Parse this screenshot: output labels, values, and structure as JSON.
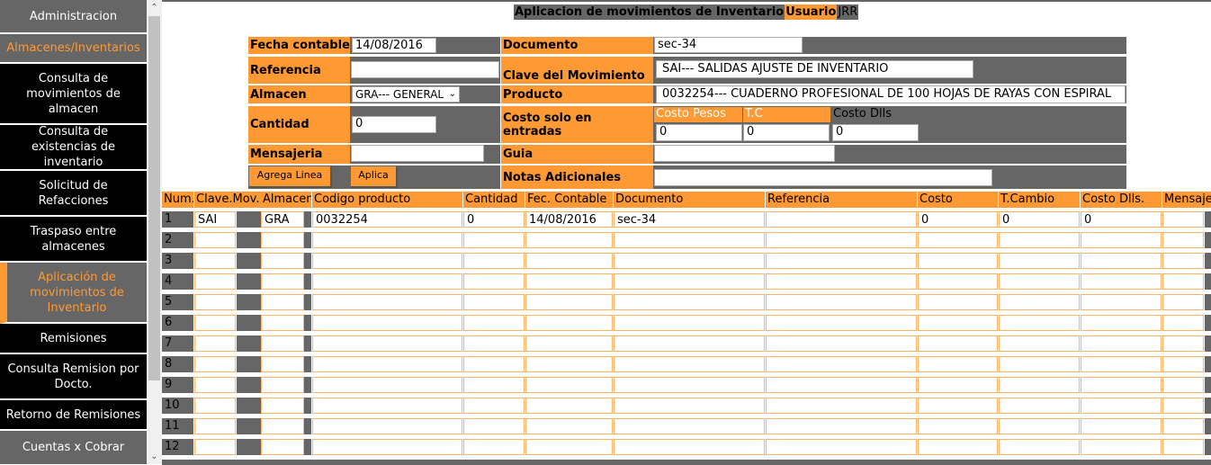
{
  "sidebar": {
    "items": [
      {
        "label": "Administracion"
      },
      {
        "label": "Almacenes/Inventarios"
      },
      {
        "label": "Consulta de movimientos de almacen"
      },
      {
        "label": "Consulta de existencias de inventario"
      },
      {
        "label": "Solicitud de Refacciones"
      },
      {
        "label": "Traspaso entre almacenes"
      },
      {
        "label": "Aplicación de movimientos de Inventario"
      },
      {
        "label": "Remisiones"
      },
      {
        "label": "Consulta Remision por Docto."
      },
      {
        "label": "Retorno de Remisiones"
      },
      {
        "label": "Cuentas x Cobrar"
      }
    ]
  },
  "header": {
    "title": "Aplicacion de movimientos de Inventario",
    "user_label": "Usuario",
    "user_value": "JRR"
  },
  "form": {
    "fecha_label": "Fecha contable",
    "fecha_value": "14/08/2016",
    "documento_label": "Documento",
    "documento_value": "sec-34",
    "referencia_label": "Referencia",
    "referencia_value": "",
    "clave_label": "Clave del Movimiento",
    "clave_value": "SAI--- SALIDAS AJUSTE DE INVENTARIO",
    "almacen_label": "Almacen",
    "almacen_value": "GRA--- GENERAL",
    "producto_label": "Producto",
    "producto_value": "0032254--- CUADERNO PROFESIONAL DE 100 HOJAS DE RAYAS CON ESPIRAL",
    "cantidad_label": "Cantidad",
    "cantidad_value": "0",
    "costo_label": "Costo solo en entradas",
    "costo_pesos_label": "Costo Pesos",
    "costo_pesos_value": "0",
    "tc_label": "T.C",
    "tc_value": "0",
    "costo_dlls_label": "Costo Dlls",
    "costo_dlls_value": "0",
    "mensajeria_label": "Mensajeria",
    "mensajeria_value": "",
    "guia_label": "Guia",
    "guia_value": "",
    "notas_label": "Notas Adicionales",
    "notas_value": "",
    "agrega_button": "Agrega Linea",
    "aplica_button": "Aplica"
  },
  "grid": {
    "headers": [
      "Num.",
      "Clave.Mov.",
      "Almacen",
      "Codigo producto",
      "Cantidad",
      "Fec. Contable",
      "Documento",
      "Referencia",
      "Costo",
      "T.Cambio",
      "Costo Dlls.",
      "Mensaje"
    ],
    "rows": [
      {
        "num": "1",
        "clave": "SAI",
        "almacen": "GRA",
        "codigo": "0032254",
        "cantidad": "0",
        "fecha": "14/08/2016",
        "documento": "sec-34",
        "referencia": "",
        "costo": "0",
        "tcambio": "0",
        "costo_dlls": "0",
        "mensaje": ""
      },
      {
        "num": "2",
        "clave": "",
        "almacen": "",
        "codigo": "",
        "cantidad": "",
        "fecha": "",
        "documento": "",
        "referencia": "",
        "costo": "",
        "tcambio": "",
        "costo_dlls": "",
        "mensaje": ""
      },
      {
        "num": "3",
        "clave": "",
        "almacen": "",
        "codigo": "",
        "cantidad": "",
        "fecha": "",
        "documento": "",
        "referencia": "",
        "costo": "",
        "tcambio": "",
        "costo_dlls": "",
        "mensaje": ""
      },
      {
        "num": "4",
        "clave": "",
        "almacen": "",
        "codigo": "",
        "cantidad": "",
        "fecha": "",
        "documento": "",
        "referencia": "",
        "costo": "",
        "tcambio": "",
        "costo_dlls": "",
        "mensaje": ""
      },
      {
        "num": "5",
        "clave": "",
        "almacen": "",
        "codigo": "",
        "cantidad": "",
        "fecha": "",
        "documento": "",
        "referencia": "",
        "costo": "",
        "tcambio": "",
        "costo_dlls": "",
        "mensaje": ""
      },
      {
        "num": "6",
        "clave": "",
        "almacen": "",
        "codigo": "",
        "cantidad": "",
        "fecha": "",
        "documento": "",
        "referencia": "",
        "costo": "",
        "tcambio": "",
        "costo_dlls": "",
        "mensaje": ""
      },
      {
        "num": "7",
        "clave": "",
        "almacen": "",
        "codigo": "",
        "cantidad": "",
        "fecha": "",
        "documento": "",
        "referencia": "",
        "costo": "",
        "tcambio": "",
        "costo_dlls": "",
        "mensaje": ""
      },
      {
        "num": "8",
        "clave": "",
        "almacen": "",
        "codigo": "",
        "cantidad": "",
        "fecha": "",
        "documento": "",
        "referencia": "",
        "costo": "",
        "tcambio": "",
        "costo_dlls": "",
        "mensaje": ""
      },
      {
        "num": "9",
        "clave": "",
        "almacen": "",
        "codigo": "",
        "cantidad": "",
        "fecha": "",
        "documento": "",
        "referencia": "",
        "costo": "",
        "tcambio": "",
        "costo_dlls": "",
        "mensaje": ""
      },
      {
        "num": "10",
        "clave": "",
        "almacen": "",
        "codigo": "",
        "cantidad": "",
        "fecha": "",
        "documento": "",
        "referencia": "",
        "costo": "",
        "tcambio": "",
        "costo_dlls": "",
        "mensaje": ""
      },
      {
        "num": "11",
        "clave": "",
        "almacen": "",
        "codigo": "",
        "cantidad": "",
        "fecha": "",
        "documento": "",
        "referencia": "",
        "costo": "",
        "tcambio": "",
        "costo_dlls": "",
        "mensaje": ""
      },
      {
        "num": "12",
        "clave": "",
        "almacen": "",
        "codigo": "",
        "cantidad": "",
        "fecha": "",
        "documento": "",
        "referencia": "",
        "costo": "",
        "tcambio": "",
        "costo_dlls": "",
        "mensaje": ""
      }
    ]
  },
  "colors": {
    "accent": "#ff9933",
    "panel": "#666666",
    "sidebar": "#000000"
  }
}
